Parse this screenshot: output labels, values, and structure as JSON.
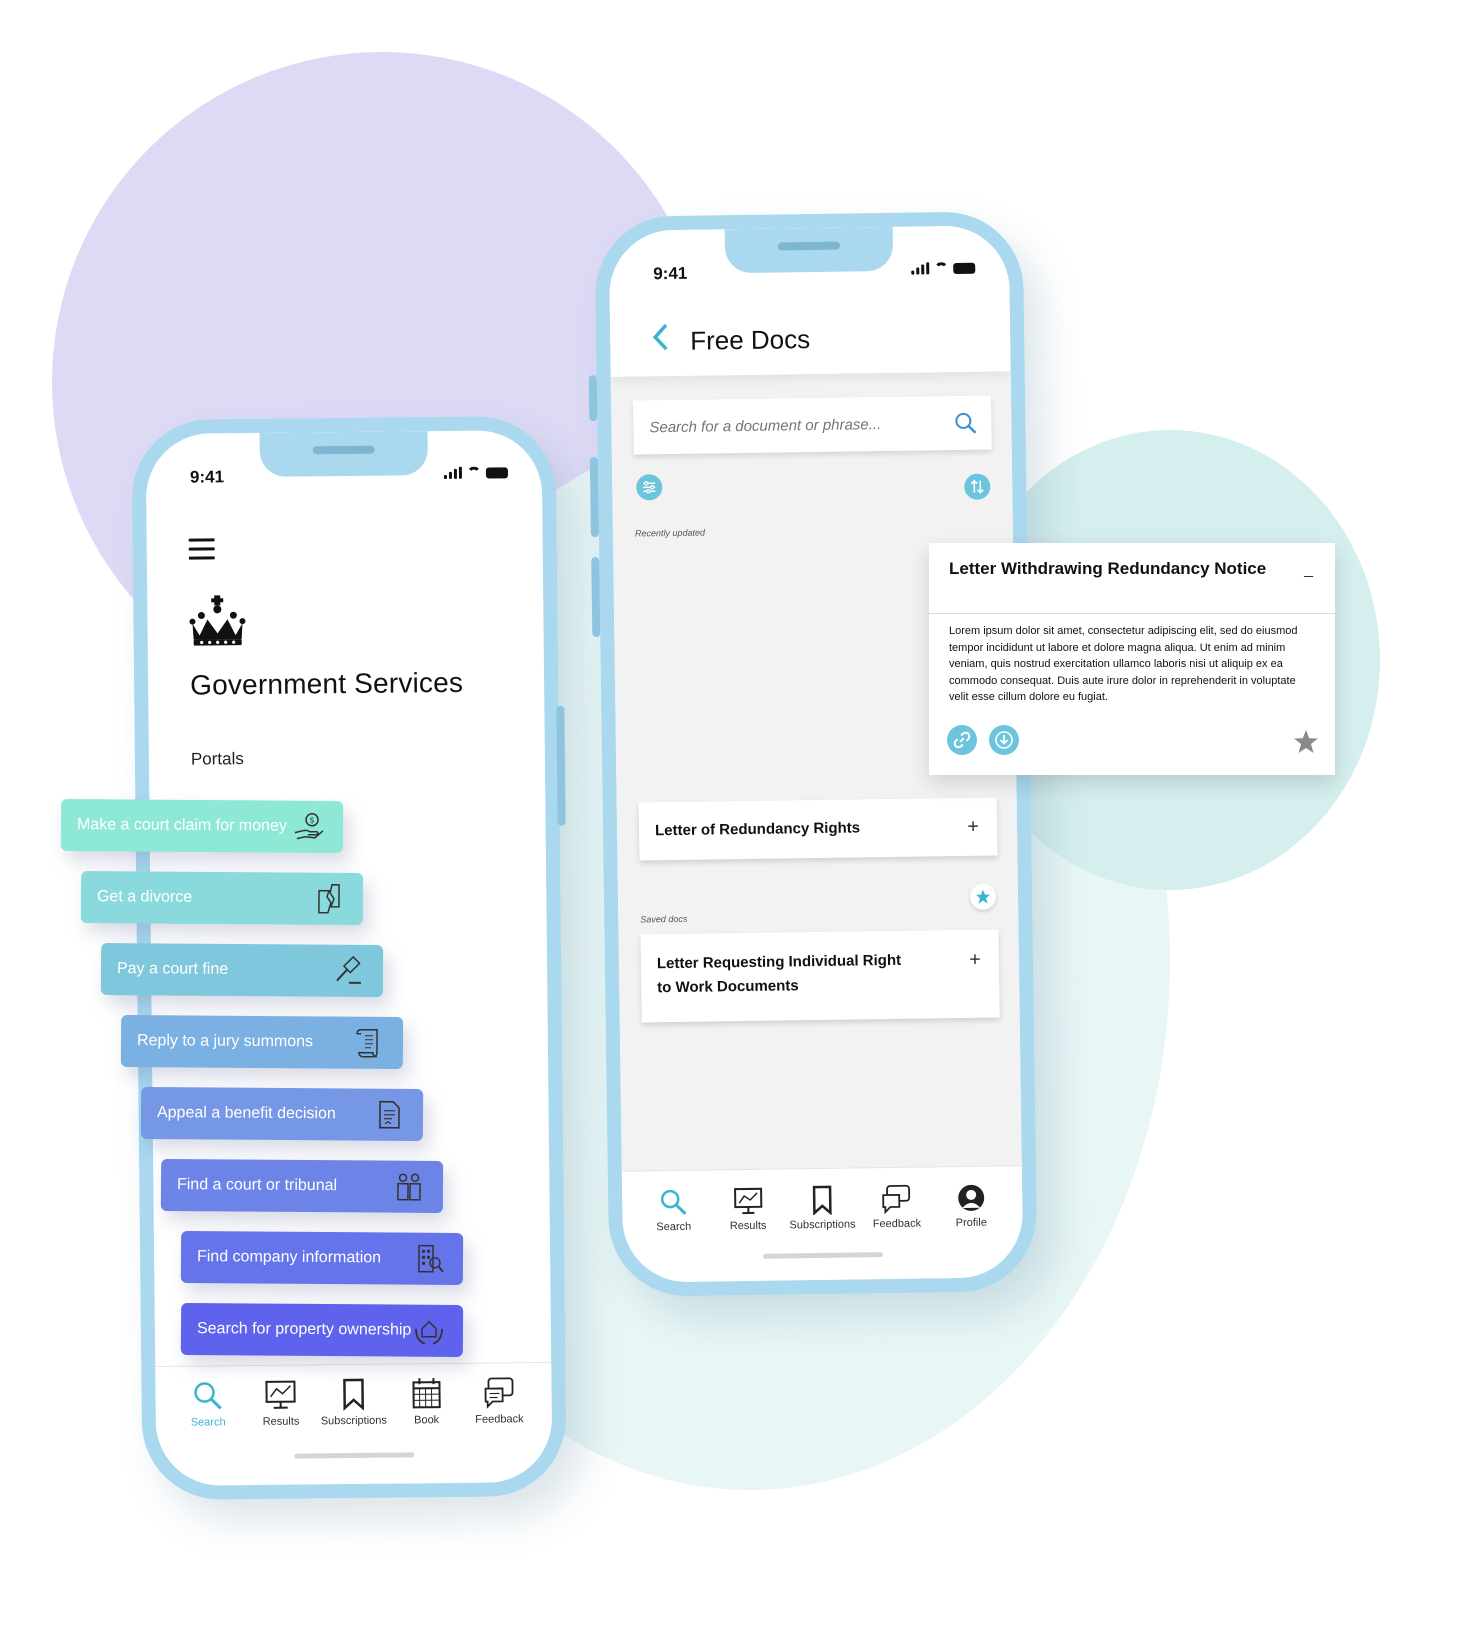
{
  "left_phone": {
    "status_time": "9:41",
    "title": "Government Services",
    "section_label": "Portals",
    "portals": [
      {
        "label": "Make a court claim for money",
        "icon": "hand-coin-icon",
        "color": "#8de8d6"
      },
      {
        "label": "Get a divorce",
        "icon": "split-document-icon",
        "color": "#8ad9dc"
      },
      {
        "label": "Pay a court fine",
        "icon": "gavel-icon",
        "color": "#7fc7dc"
      },
      {
        "label": "Reply to a jury summons",
        "icon": "scroll-icon",
        "color": "#7ab0e2"
      },
      {
        "label": "Appeal a benefit decision",
        "icon": "document-icon",
        "color": "#7597e6"
      },
      {
        "label": "Find a court or tribunal",
        "icon": "people-icon",
        "color": "#6c84e8"
      },
      {
        "label": "Find company information",
        "icon": "building-icon",
        "color": "#6574ea"
      },
      {
        "label": "Search for property ownership",
        "icon": "house-hands-icon",
        "color": "#5e62ec"
      }
    ],
    "tabs": [
      {
        "label": "Search",
        "icon": "search-icon",
        "active": true
      },
      {
        "label": "Results",
        "icon": "chart-monitor-icon"
      },
      {
        "label": "Subscriptions",
        "icon": "bookmark-icon"
      },
      {
        "label": "Book",
        "icon": "calendar-icon"
      },
      {
        "label": "Feedback",
        "icon": "feedback-icon"
      }
    ]
  },
  "right_phone": {
    "status_time": "9:41",
    "title": "Free Docs",
    "search_placeholder": "Search for a document or phrase...",
    "recently_updated_label": "Recently updated",
    "saved_docs_label": "Saved docs",
    "docs": [
      {
        "title": "Letter of Redundancy Rights",
        "action": "+"
      },
      {
        "title": "Letter Requesting Individual Right to Work Documents",
        "action": "+"
      }
    ],
    "tabs": [
      {
        "label": "Search",
        "icon": "search-icon"
      },
      {
        "label": "Results",
        "icon": "chart-monitor-icon"
      },
      {
        "label": "Subscriptions",
        "icon": "bookmark-icon"
      },
      {
        "label": "Feedback",
        "icon": "feedback-icon"
      },
      {
        "label": "Profile",
        "icon": "profile-icon"
      }
    ]
  },
  "popup": {
    "title": "Letter Withdrawing Redundancy Notice",
    "collapse": "_",
    "body": "Lorem ipsum dolor sit amet, consectetur adipiscing elit, sed do eiusmod tempor incididunt ut labore et dolore magna aliqua. Ut enim ad minim veniam, quis nostrud exercitation ullamco laboris nisi ut aliquip ex ea commodo consequat. Duis aute irure dolor in reprehenderit in voluptate velit esse cillum dolore eu fugiat."
  },
  "colors": {
    "accent": "#6cc4dd",
    "phone_frame": "#a9d8ef"
  }
}
